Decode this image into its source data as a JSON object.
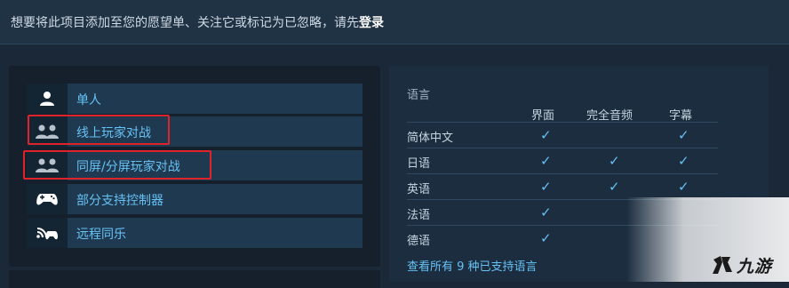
{
  "login_prompt": {
    "text": "想要将此项目添加至您的愿望单、关注它或标记为已忽略，请先",
    "login_link": "登录"
  },
  "features": [
    {
      "label": "单人",
      "icon": "single-player-icon",
      "highlighted": false
    },
    {
      "label": "线上玩家对战",
      "icon": "online-pvp-icon",
      "highlighted": true
    },
    {
      "label": "同屏/分屏玩家对战",
      "icon": "shared-screen-pvp-icon",
      "highlighted": true
    },
    {
      "label": "部分支持控制器",
      "icon": "controller-icon",
      "highlighted": false
    },
    {
      "label": "远程同乐",
      "icon": "remote-play-together-icon",
      "highlighted": false
    }
  ],
  "languages": {
    "title": "语言",
    "columns": [
      "界面",
      "完全音频",
      "字幕"
    ],
    "rows": [
      {
        "name": "简体中文",
        "interface": true,
        "audio": false,
        "subtitles": true
      },
      {
        "name": "日语",
        "interface": true,
        "audio": true,
        "subtitles": true
      },
      {
        "name": "英语",
        "interface": true,
        "audio": true,
        "subtitles": true
      },
      {
        "name": "法语",
        "interface": true,
        "audio": false,
        "subtitles": false
      },
      {
        "name": "德语",
        "interface": true,
        "audio": false,
        "subtitles": false
      }
    ],
    "check_mark": "✓",
    "see_all_link": "查看所有 9 种已支持语言"
  },
  "watermark": {
    "text": "九游"
  },
  "colors": {
    "background": "#1b2838",
    "link_blue": "#67c1f5",
    "highlight_red": "#e0222a"
  }
}
